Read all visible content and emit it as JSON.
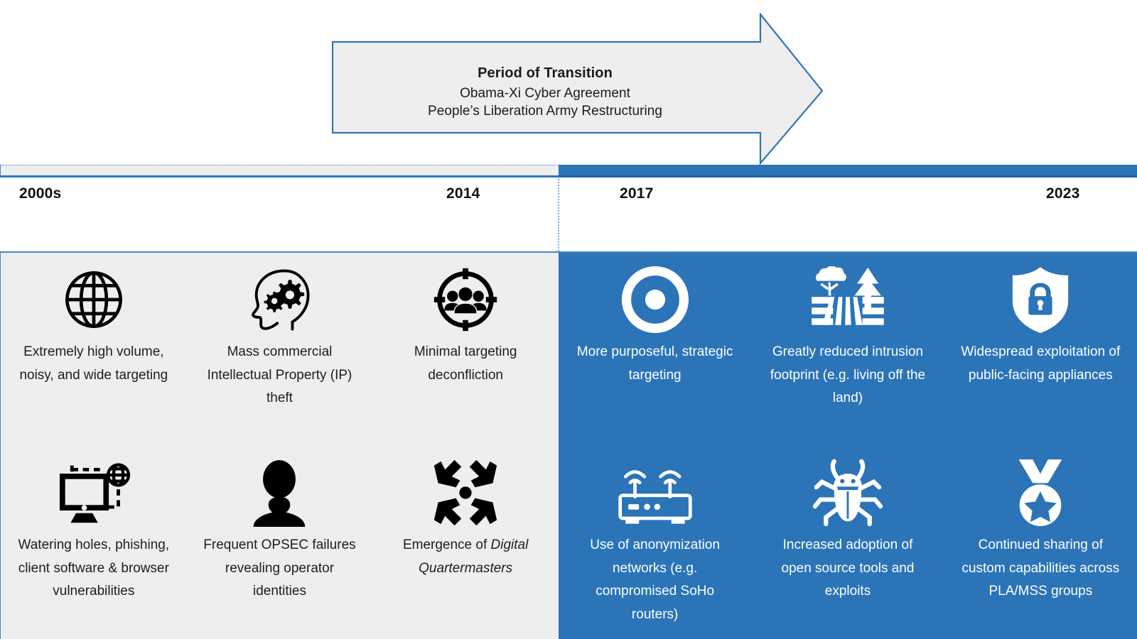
{
  "arrow": {
    "title": "Period of Transition",
    "line1": "Obama-Xi Cyber Agreement",
    "line2": "People’s Liberation Army Restructuring"
  },
  "timeline": {
    "years": [
      "2000s",
      "2014",
      "2017",
      "2023"
    ],
    "left_color": "#eeeeee",
    "right_color": "#2b74b8",
    "border_color": "#4a87c4"
  },
  "past_panel": {
    "background": "#eeeeee",
    "items": [
      {
        "icon": "globe-grid-icon",
        "label": "Extremely high volume, noisy, and wide targeting"
      },
      {
        "icon": "head-gears-icon",
        "label": "Mass commercial Intellectual Property (IP) theft"
      },
      {
        "icon": "crosshair-people-icon",
        "label": "Minimal targeting deconfliction"
      },
      {
        "icon": "monitor-globe-icon",
        "label": "Watering holes, phishing, client software & browser vulnerabilities"
      },
      {
        "icon": "person-silhouette-icon",
        "label": "Frequent OPSEC failures revealing operator identities"
      },
      {
        "icon": "converging-arrows-icon",
        "label_pre": "Emergence of ",
        "label_em": "Digital Quartermasters",
        "label": "Emergence of Digital Quartermasters"
      }
    ]
  },
  "present_panel": {
    "background": "#2b74b8",
    "items": [
      {
        "icon": "target-ring-icon",
        "label": "More purposeful, strategic targeting"
      },
      {
        "icon": "field-trees-icon",
        "label": "Greatly reduced intrusion footprint (e.g. living off the land)"
      },
      {
        "icon": "shield-lock-icon",
        "label": "Widespread exploitation of public-facing appliances"
      },
      {
        "icon": "wifi-router-icon",
        "label": "Use of anonymization networks (e.g. compromised SoHo routers)"
      },
      {
        "icon": "bug-icon",
        "label": "Increased adoption of open source tools and exploits"
      },
      {
        "icon": "medal-star-icon",
        "label": "Continued sharing of custom capabilities across PLA/MSS groups"
      }
    ]
  }
}
